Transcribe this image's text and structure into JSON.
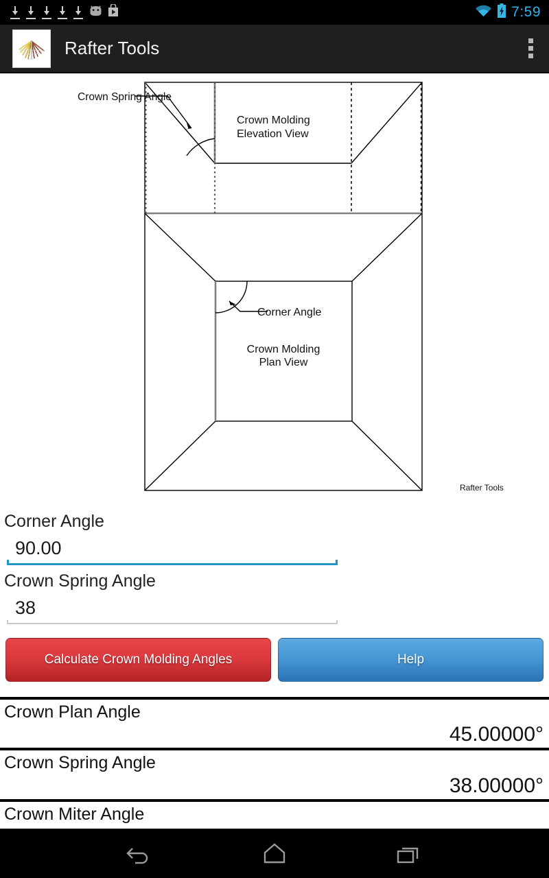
{
  "statusbar": {
    "icons": [
      "download-icon",
      "download-icon",
      "download-icon",
      "download-icon",
      "download-icon",
      "android-icon",
      "play-store-icon"
    ],
    "wifi": "wifi-icon",
    "battery": "battery-charging-icon",
    "clock": "7:59",
    "accent_color": "#30b0e8"
  },
  "actionbar": {
    "logo": "rafter-tools-logo",
    "title": "Rafter Tools",
    "overflow": "overflow-menu-icon",
    "background": "#1f1f1f"
  },
  "diagram": {
    "label_crown_spring_angle": "Crown Spring Angle",
    "label_elevation_line1": "Crown Molding",
    "label_elevation_line2": "Elevation View",
    "label_corner_angle": "Corner Angle",
    "label_plan_line1": "Crown Molding",
    "label_plan_line2": "Plan View",
    "watermark": "Rafter Tools"
  },
  "form": {
    "fields": [
      {
        "label": "Corner Angle",
        "value": "90.00",
        "placeholder": "Corner Angle",
        "focused": true
      },
      {
        "label": "Crown Spring Angle",
        "value": "38",
        "placeholder": "Crown Spring Angle",
        "focused": false
      }
    ],
    "focus_color": "#2196c4",
    "idle_color": "#c9c9c9"
  },
  "buttons": {
    "calculate": "Calculate Crown Molding Angles",
    "help": "Help",
    "calculate_color": "#dc3a3e",
    "help_color": "#4897d4"
  },
  "results": [
    {
      "label": "Crown Plan Angle",
      "value": "45.00000°"
    },
    {
      "label": "Crown Spring Angle",
      "value": "38.00000°"
    },
    {
      "label": "Crown Miter Angle",
      "value": ""
    }
  ],
  "navbar": {
    "back": "back-icon",
    "home": "home-icon",
    "recents": "recent-apps-icon"
  }
}
